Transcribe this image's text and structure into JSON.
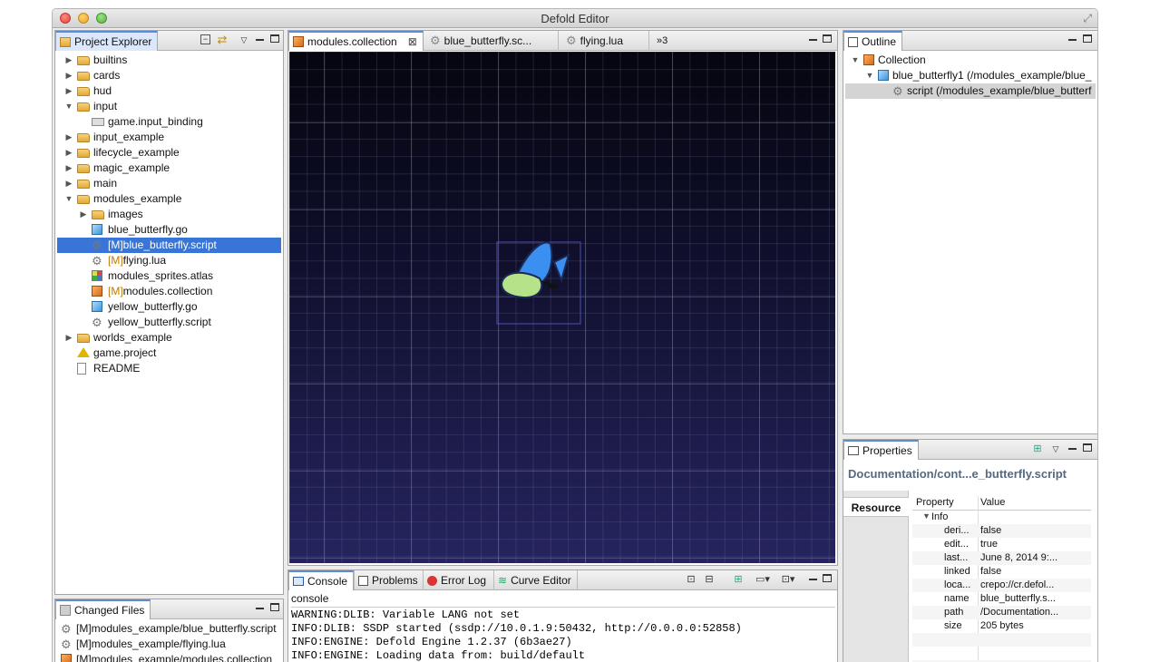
{
  "window": {
    "title": "Defold Editor"
  },
  "project_explorer": {
    "tab_label": "Project Explorer",
    "items": [
      {
        "label": "builtins",
        "type": "folder",
        "depth": 0,
        "expanded": false
      },
      {
        "label": "cards",
        "type": "folder",
        "depth": 0,
        "expanded": false
      },
      {
        "label": "hud",
        "type": "folder",
        "depth": 0,
        "expanded": false
      },
      {
        "label": "input",
        "type": "folder",
        "depth": 0,
        "expanded": true
      },
      {
        "label": "game.input_binding",
        "type": "input-binding",
        "depth": 1
      },
      {
        "label": "input_example",
        "type": "folder",
        "depth": 0,
        "expanded": false
      },
      {
        "label": "lifecycle_example",
        "type": "folder",
        "depth": 0,
        "expanded": false
      },
      {
        "label": "magic_example",
        "type": "folder",
        "depth": 0,
        "expanded": false
      },
      {
        "label": "main",
        "type": "folder",
        "depth": 0,
        "expanded": false
      },
      {
        "label": "modules_example",
        "type": "folder",
        "depth": 0,
        "expanded": true
      },
      {
        "label": "images",
        "type": "folder",
        "depth": 1,
        "expanded": false
      },
      {
        "label": "blue_butterfly.go",
        "type": "gameobject",
        "depth": 1
      },
      {
        "label": "blue_butterfly.script",
        "prefix": "[M]",
        "type": "script",
        "depth": 1,
        "selected": true
      },
      {
        "label": "flying.lua",
        "prefix": "[M]",
        "type": "script",
        "depth": 1
      },
      {
        "label": "modules_sprites.atlas",
        "type": "atlas",
        "depth": 1
      },
      {
        "label": "modules.collection",
        "prefix": "[M]",
        "type": "collection",
        "depth": 1
      },
      {
        "label": "yellow_butterfly.go",
        "type": "gameobject",
        "depth": 1
      },
      {
        "label": "yellow_butterfly.script",
        "type": "script",
        "depth": 1
      },
      {
        "label": "worlds_example",
        "type": "folder",
        "depth": 0,
        "expanded": false
      },
      {
        "label": "game.project",
        "type": "project",
        "depth": 0
      },
      {
        "label": "README",
        "type": "document",
        "depth": 0
      }
    ]
  },
  "changed_files": {
    "tab_label": "Changed Files",
    "items": [
      {
        "label": "[M]modules_example/blue_butterfly.script",
        "type": "script"
      },
      {
        "label": "[M]modules_example/flying.lua",
        "type": "script"
      },
      {
        "label": "[M]modules_example/modules.collection",
        "type": "collection"
      }
    ]
  },
  "editor": {
    "tabs": [
      {
        "label": "modules.collection",
        "active": true
      },
      {
        "label": "blue_butterfly.sc...",
        "active": false
      },
      {
        "label": "flying.lua",
        "active": false
      }
    ],
    "overflow_label": "»3"
  },
  "console": {
    "tabs": [
      "Console",
      "Problems",
      "Error Log",
      "Curve Editor"
    ],
    "header": "console",
    "lines": [
      "WARNING:DLIB: Variable LANG not set",
      "INFO:DLIB: SSDP started (ssdp://10.0.1.9:50432, http://0.0.0.0:52858)",
      "INFO:ENGINE: Defold Engine 1.2.37 (6b3ae27)",
      "INFO:ENGINE: Loading data from: build/default"
    ]
  },
  "outline": {
    "tab_label": "Outline",
    "items": [
      {
        "label": "Collection",
        "depth": 0
      },
      {
        "label": "blue_butterfly1 (/modules_example/blue_",
        "depth": 1
      },
      {
        "label": "script (/modules_example/blue_butterf",
        "depth": 2,
        "selected": true
      }
    ]
  },
  "properties": {
    "tab_label": "Properties",
    "title": "Documentation/cont...e_butterfly.script",
    "side_tab": "Resource",
    "columns": [
      "Property",
      "Value"
    ],
    "group": "Info",
    "rows": [
      {
        "property": "deri...",
        "value": "false"
      },
      {
        "property": "edit...",
        "value": "true"
      },
      {
        "property": "last...",
        "value": "June 8, 2014 9:..."
      },
      {
        "property": "linked",
        "value": "false"
      },
      {
        "property": "loca...",
        "value": "crepo://cr.defol..."
      },
      {
        "property": "name",
        "value": "blue_butterfly.s..."
      },
      {
        "property": "path",
        "value": "/Documentation..."
      },
      {
        "property": "size",
        "value": "205  bytes"
      }
    ]
  }
}
